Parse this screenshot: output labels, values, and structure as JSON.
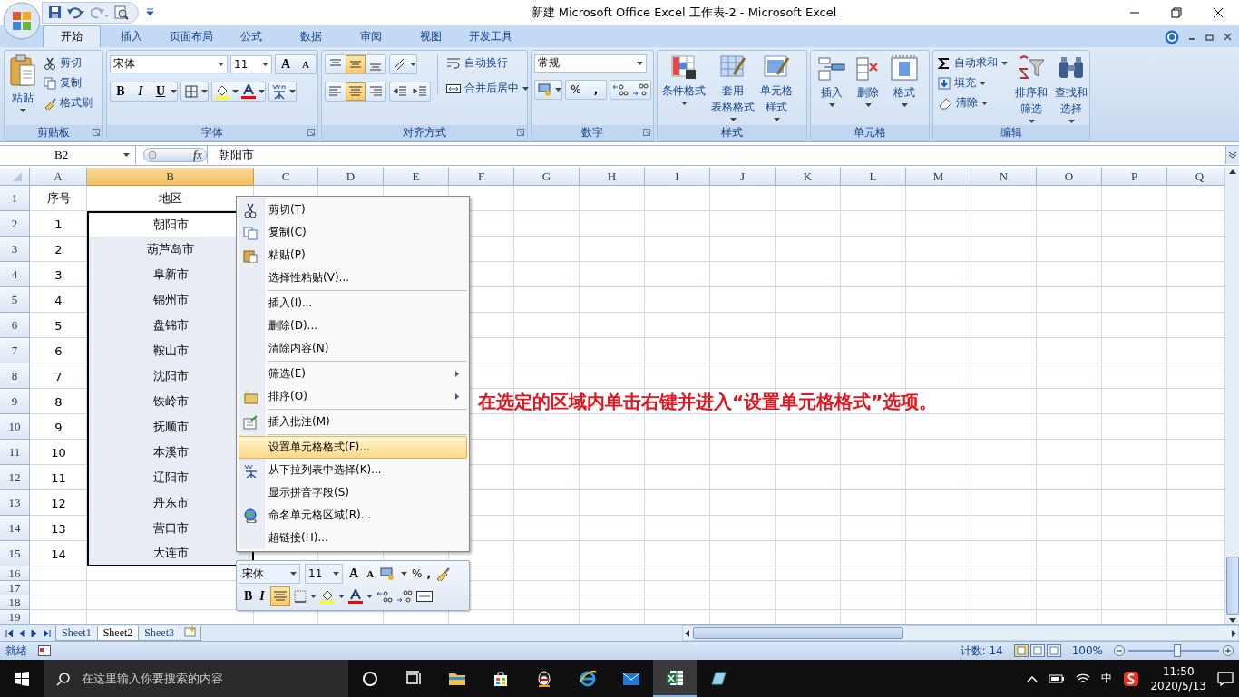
{
  "title_bar": {
    "title": "新建 Microsoft Office Excel 工作表-2 - Microsoft Excel"
  },
  "ribbon": {
    "tabs": [
      {
        "label": "开始",
        "selected": true
      },
      {
        "label": "插入",
        "selected": false
      },
      {
        "label": "页面布局",
        "selected": false
      },
      {
        "label": "公式",
        "selected": false
      },
      {
        "label": "数据",
        "selected": false
      },
      {
        "label": "审阅",
        "selected": false
      },
      {
        "label": "视图",
        "selected": false
      },
      {
        "label": "开发工具",
        "selected": false
      }
    ],
    "clipboard": {
      "title": "剪贴板",
      "paste": "粘贴",
      "cut": "剪切",
      "copy": "复制",
      "format_painter": "格式刷"
    },
    "font": {
      "title": "字体",
      "font_name": "宋体",
      "font_size": "11",
      "size_buttons": [
        "A",
        "A"
      ],
      "style_buttons": [
        "B",
        "I",
        "U"
      ]
    },
    "alignment": {
      "title": "对齐方式",
      "vertical": [
        {
          "kind": "top",
          "selected": false
        },
        {
          "kind": "middle",
          "selected": true
        },
        {
          "kind": "bottom",
          "selected": false
        }
      ],
      "horizontal": [
        {
          "kind": "left",
          "selected": false
        },
        {
          "kind": "center",
          "selected": true
        },
        {
          "kind": "right",
          "selected": false
        }
      ],
      "wrap": "自动换行",
      "merge": "合并后居中"
    },
    "number": {
      "title": "数字",
      "format": "常规",
      "percent": "%",
      "comma": ","
    },
    "styles": {
      "title": "样式",
      "buttons": [
        {
          "lines": [
            "条件格式"
          ]
        },
        {
          "lines": [
            "套用",
            "表格格式"
          ]
        },
        {
          "lines": [
            "单元格",
            "样式"
          ]
        }
      ]
    },
    "cells": {
      "title": "单元格",
      "buttons": [
        {
          "lines": [
            "插入"
          ]
        },
        {
          "lines": [
            "删除"
          ]
        },
        {
          "lines": [
            "格式"
          ]
        }
      ]
    },
    "editing": {
      "title": "编辑",
      "autosum": "自动求和",
      "fill": "填充",
      "clear": "清除",
      "buttons": [
        {
          "lines": [
            "排序和",
            "筛选"
          ]
        },
        {
          "lines": [
            "查找和",
            "选择"
          ]
        }
      ]
    }
  },
  "formula_bar": {
    "name_box": "B2",
    "fx": "fx",
    "content": "朝阳市"
  },
  "sheet": {
    "columns": [
      {
        "label": "A",
        "selected": false
      },
      {
        "label": "B",
        "selected": true
      },
      {
        "label": "C",
        "selected": false
      },
      {
        "label": "D",
        "selected": false
      },
      {
        "label": "E",
        "selected": false
      },
      {
        "label": "F",
        "selected": false
      },
      {
        "label": "G",
        "selected": false
      },
      {
        "label": "H",
        "selected": false
      },
      {
        "label": "I",
        "selected": false
      },
      {
        "label": "J",
        "selected": false
      },
      {
        "label": "K",
        "selected": false
      },
      {
        "label": "L",
        "selected": false
      },
      {
        "label": "M",
        "selected": false
      },
      {
        "label": "N",
        "selected": false
      },
      {
        "label": "O",
        "selected": false
      },
      {
        "label": "P",
        "selected": false
      },
      {
        "label": "Q",
        "selected": false
      }
    ],
    "rows": [
      {
        "header": "1",
        "cells": [
          {
            "text": "序号",
            "selected": false
          },
          {
            "text": "地区",
            "selected": false
          }
        ]
      },
      {
        "header": "2",
        "cells": [
          {
            "text": "1",
            "selected": false
          },
          {
            "text": "朝阳市",
            "selected": true,
            "active": true
          }
        ]
      },
      {
        "header": "3",
        "cells": [
          {
            "text": "2",
            "selected": false
          },
          {
            "text": "葫芦岛市",
            "selected": true
          }
        ]
      },
      {
        "header": "4",
        "cells": [
          {
            "text": "3",
            "selected": false
          },
          {
            "text": "阜新市",
            "selected": true
          }
        ]
      },
      {
        "header": "5",
        "cells": [
          {
            "text": "4",
            "selected": false
          },
          {
            "text": "锦州市",
            "selected": true
          }
        ]
      },
      {
        "header": "6",
        "cells": [
          {
            "text": "5",
            "selected": false
          },
          {
            "text": "盘锦市",
            "selected": true
          }
        ]
      },
      {
        "header": "7",
        "cells": [
          {
            "text": "6",
            "selected": false
          },
          {
            "text": "鞍山市",
            "selected": true
          }
        ]
      },
      {
        "header": "8",
        "cells": [
          {
            "text": "7",
            "selected": false
          },
          {
            "text": "沈阳市",
            "selected": true
          }
        ]
      },
      {
        "header": "9",
        "cells": [
          {
            "text": "8",
            "selected": false
          },
          {
            "text": "铁岭市",
            "selected": true
          }
        ]
      },
      {
        "header": "10",
        "cells": [
          {
            "text": "9",
            "selected": false
          },
          {
            "text": "抚顺市",
            "selected": true
          }
        ]
      },
      {
        "header": "11",
        "cells": [
          {
            "text": "10",
            "selected": false
          },
          {
            "text": "本溪市",
            "selected": true
          }
        ]
      },
      {
        "header": "12",
        "cells": [
          {
            "text": "11",
            "selected": false
          },
          {
            "text": "辽阳市",
            "selected": true
          }
        ]
      },
      {
        "header": "13",
        "cells": [
          {
            "text": "12",
            "selected": false
          },
          {
            "text": "丹东市",
            "selected": true
          }
        ]
      },
      {
        "header": "14",
        "cells": [
          {
            "text": "13",
            "selected": false
          },
          {
            "text": "营口市",
            "selected": true
          }
        ]
      },
      {
        "header": "15",
        "cells": [
          {
            "text": "14",
            "selected": false
          },
          {
            "text": "大连市",
            "selected": true
          }
        ]
      },
      {
        "header": "16"
      },
      {
        "header": "17"
      },
      {
        "header": "18"
      },
      {
        "header": "19"
      }
    ]
  },
  "context_menu": {
    "groups": [
      [
        {
          "label": "剪切(T)",
          "submenu": false,
          "selected": false
        },
        {
          "label": "复制(C)",
          "submenu": false,
          "selected": false
        },
        {
          "label": "粘贴(P)",
          "submenu": false,
          "selected": false
        },
        {
          "label": "选择性粘贴(V)...",
          "submenu": false,
          "selected": false
        }
      ],
      [
        {
          "label": "插入(I)...",
          "submenu": false,
          "selected": false
        },
        {
          "label": "删除(D)...",
          "submenu": false,
          "selected": false
        },
        {
          "label": "清除内容(N)",
          "submenu": false,
          "selected": false
        }
      ],
      [
        {
          "label": "筛选(E)",
          "submenu": true,
          "selected": false
        },
        {
          "label": "排序(O)",
          "submenu": true,
          "selected": false
        }
      ],
      [
        {
          "label": "插入批注(M)",
          "submenu": false,
          "selected": false
        }
      ],
      [
        {
          "label": "设置单元格格式(F)...",
          "submenu": false,
          "selected": true
        },
        {
          "label": "从下拉列表中选择(K)...",
          "submenu": false,
          "selected": false
        },
        {
          "label": "显示拼音字段(S)",
          "submenu": false,
          "selected": false
        },
        {
          "label": "命名单元格区域(R)...",
          "submenu": false,
          "selected": false
        },
        {
          "label": "超链接(H)...",
          "submenu": false,
          "selected": false
        }
      ]
    ]
  },
  "mini_toolbar": {
    "font_name": "宋体",
    "font_size": "11",
    "size_buttons": [
      "A",
      "A"
    ],
    "percent": "%",
    "comma": ",",
    "style_buttons": [
      "B",
      "I"
    ],
    "center_align": {
      "selected": true
    }
  },
  "annotation": "在选定的区域内单击右键并进入“设置单元格格式”选项。",
  "sheet_tabs": [
    {
      "label": "Sheet1",
      "selected": false
    },
    {
      "label": "Sheet2",
      "selected": true
    },
    {
      "label": "Sheet3",
      "selected": false
    }
  ],
  "status_bar": {
    "status": "就绪",
    "count": "计数: 14",
    "zoom": "100%"
  },
  "taskbar": {
    "search_placeholder": "在这里输入你要搜索的内容",
    "ime": "中",
    "time": "11:50",
    "date": "2020/5/13"
  }
}
